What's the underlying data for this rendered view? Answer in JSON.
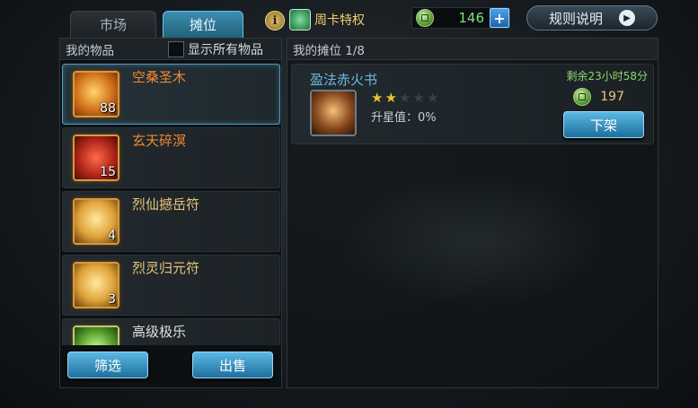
{
  "tabs": {
    "market": "市场",
    "stall": "摊位"
  },
  "topbar": {
    "info_label": "i",
    "weekly_card": "周卡特权",
    "currency_amount": "146",
    "add_label": "+",
    "rules_label": "规则说明"
  },
  "left_panel": {
    "title": "我的物品",
    "show_all_label": "显示所有物品",
    "items": [
      {
        "name": "空桑圣木",
        "count": "88"
      },
      {
        "name": "玄天碎溟",
        "count": "15"
      },
      {
        "name": "烈仙撼岳符",
        "count": "4"
      },
      {
        "name": "烈灵归元符",
        "count": "3"
      },
      {
        "name": "高级极乐",
        "count": ""
      }
    ],
    "filter_label": "筛选",
    "sell_label": "出售"
  },
  "right_panel": {
    "title": "我的摊位 1/8",
    "listing": {
      "name": "盈法赤火书",
      "stars_filled": 2,
      "stars_total": 5,
      "star_value": "升星值：0%",
      "remaining": "剩余23小时58分",
      "price": "197",
      "delist_label": "下架"
    }
  }
}
